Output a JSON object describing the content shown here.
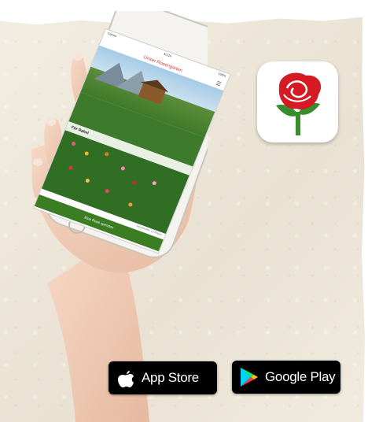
{
  "phone": {
    "status_left": "Carrier",
    "status_time": "10:24",
    "status_right": "100%",
    "app_title": "Unser Rosengarten",
    "garden_label": "Für Rahel",
    "caption": "Gespendet: 12 Rosen",
    "cta_label": "Eine Rose spenden",
    "menu_icon": "hamburger-icon"
  },
  "app_icon": {
    "icon": "rose-icon",
    "colors": {
      "petal": "#d51a23",
      "stem": "#3a8d2c"
    }
  },
  "badges": {
    "app_store": {
      "label": "App Store",
      "icon": "apple-icon"
    },
    "google_play": {
      "label": "Google Play",
      "icon": "google-play-icon"
    }
  },
  "colors": {
    "accent_green": "#3b7d22",
    "title_red": "#d13a2e"
  }
}
